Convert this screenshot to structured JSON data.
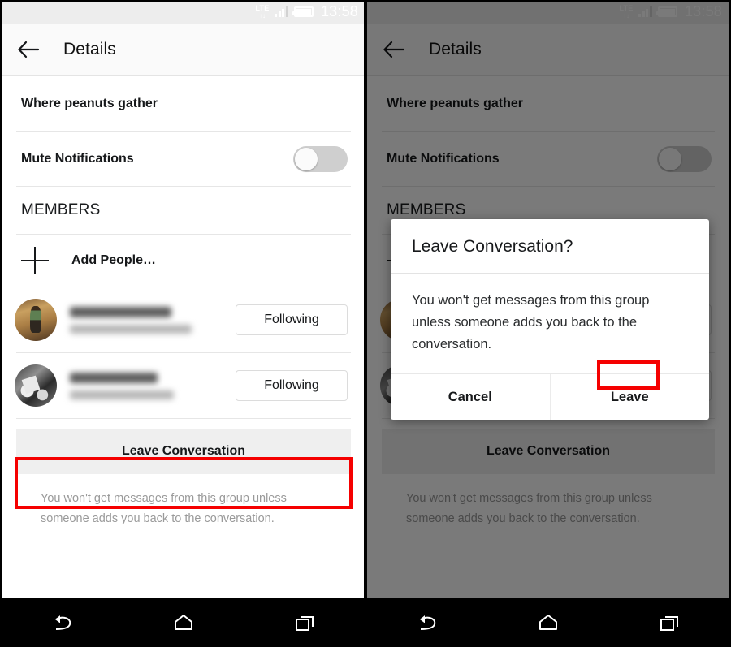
{
  "statusbar": {
    "network_label": "LTE",
    "data_arrows": "↑↓",
    "clock": "13:58",
    "signal_icon": "signal-bars-icon",
    "battery_icon": "battery-full-icon"
  },
  "actionbar": {
    "back_icon": "back-arrow-icon",
    "title": "Details"
  },
  "details": {
    "group_name": "Where peanuts gather",
    "mute_label": "Mute Notifications",
    "mute_state": "off",
    "members_header": "MEMBERS",
    "add_people_label": "Add People…",
    "add_people_icon": "plus-icon",
    "members": [
      {
        "name": "",
        "subtitle": "",
        "action_label": "Following",
        "avatar": "avatar-color-photo",
        "redacted": true
      },
      {
        "name": "",
        "subtitle": "",
        "action_label": "Following",
        "avatar": "avatar-bw-photo",
        "redacted": true
      }
    ],
    "leave_button_label": "Leave Conversation",
    "leave_note": "You won't get messages from this group unless someone adds you back to the conversation."
  },
  "dialog": {
    "title": "Leave Conversation?",
    "body": "You won't get messages from this group unless someone adds you back to the conversation.",
    "cancel_label": "Cancel",
    "confirm_label": "Leave"
  },
  "navbar": {
    "back_icon": "nav-back-icon",
    "home_icon": "nav-home-icon",
    "recents_icon": "nav-recents-icon"
  },
  "annotations": {
    "color": "#f50000",
    "highlighted": [
      "Leave Conversation",
      "Leave"
    ]
  }
}
